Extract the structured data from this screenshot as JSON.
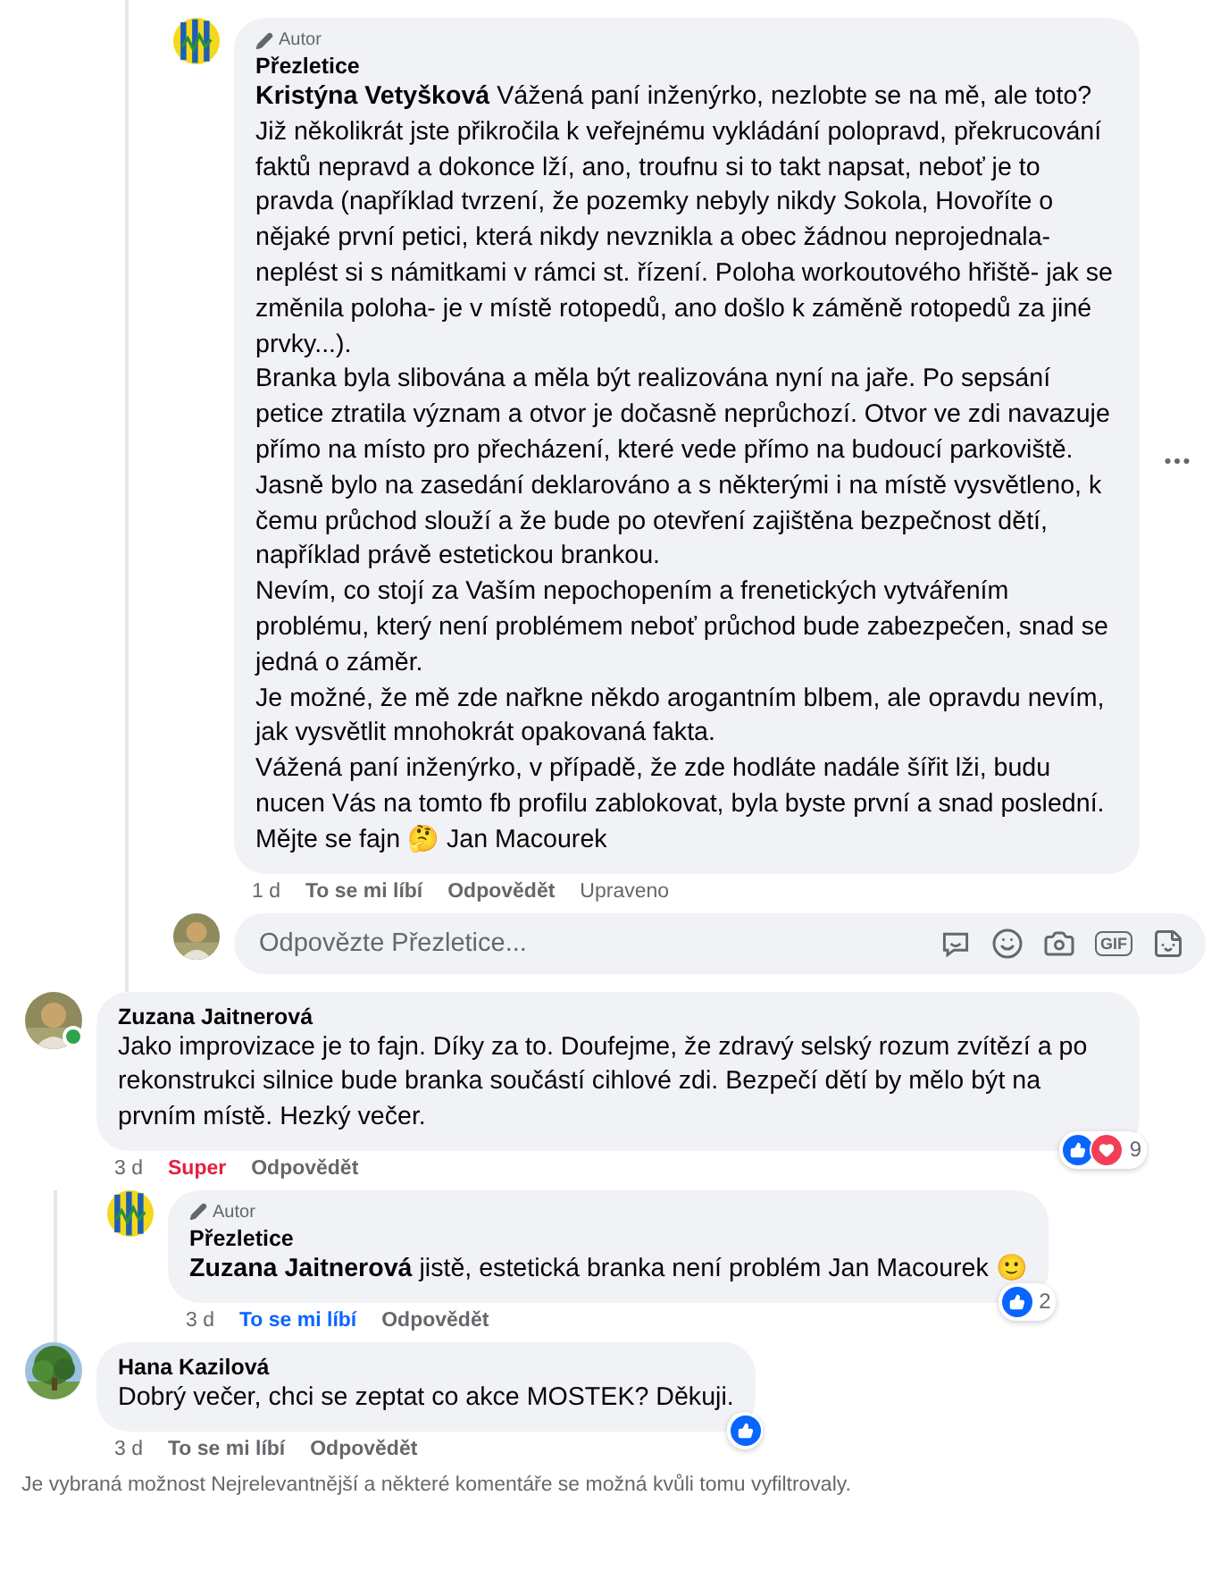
{
  "author_reply": {
    "badge": "Autor",
    "author": "Přezletice",
    "paragraphs": [
      "**Kristýna Vetyšková** Vážená paní inženýrko, nezlobte se na mě, ale toto? Již několikrát jste přikročila k veřejnému vykládání polopravd, překrucování faktů nepravd a dokonce lží, ano, troufnu si to takt napsat, neboť je to pravda (například tvrzení, že pozemky nebyly nikdy Sokola, Hovoříte o nějaké první petici, která nikdy nevznikla a obec žádnou neprojednala- neplést si s námitkami v rámci st. řízení. Poloha workoutového hřiště- jak se změnila poloha- je v místě rotopedů, ano došlo k záměně rotopedů za jiné prvky...).",
      "Branka byla slibována a měla být realizována nyní na jaře. Po sepsání petice ztratila význam a otvor je dočasně neprůchozí. Otvor ve zdi navazuje přímo na místo pro přecházení, které vede přímo na budoucí parkoviště.",
      "Jasně bylo na zasedání deklarováno a s některými i na místě vysvětleno, k čemu průchod slouží a že bude po otevření zajištěna bezpečnost dětí, například právě estetickou brankou.",
      "Nevím, co stojí za Vaším nepochopením a frenetických vytvářením problému, který není problémem neboť průchod bude zabezpečen, snad se jedná o záměr.",
      "Je možné, že mě zde nařkne někdo arogantním blbem, ale opravdu nevím, jak vysvětlit mnohokrát opakovaná fakta.",
      "Vážená paní inženýrko, v případě, že zde hodláte nadále šířit lži, budu nucen Vás na tomto fb profilu zablokovat, byla byste první a snad poslední.",
      "Mějte se fajn 🤔 Jan Macourek"
    ],
    "time": "1 d",
    "like": "To se mi líbí",
    "reply": "Odpovědět",
    "edited": "Upraveno"
  },
  "composer": {
    "placeholder": "Odpovězte Přezletice...",
    "gif_label": "GIF"
  },
  "comments": [
    {
      "author": "Zuzana Jaitnerová",
      "online": true,
      "text": "Jako improvizace je to fajn. Díky za to. Doufejme, že zdravý selský rozum zvítězí a po rekonstrukci silnice bude branka součástí cihlové zdi. Bezpečí dětí by mělo být na prvním místě. Hezký večer.",
      "reactions": [
        {
          "kind": "like"
        },
        {
          "kind": "love"
        }
      ],
      "reaction_count": "9",
      "time": "3 d",
      "my_reaction": {
        "kind": "love"
      },
      "like": "Super",
      "reply": "Odpovědět",
      "replies": [
        {
          "badge": "Autor",
          "author": "Přezletice",
          "text": "**Zuzana Jaitnerová** jistě, estetická branka není problém Jan Macourek 🙂",
          "reactions": [
            {
              "kind": "like"
            }
          ],
          "reaction_count": "2",
          "time": "3 d",
          "my_reaction": {
            "kind": "like"
          },
          "like": "To se mi líbí",
          "reply": "Odpovědět"
        }
      ]
    },
    {
      "author": "Hana Kazilová",
      "online": false,
      "text": "Dobrý večer, chci se zeptat co akce MOSTEK? Děkuji.",
      "reactions": [
        {
          "kind": "like"
        }
      ],
      "time": "3 d",
      "like": "To se mi líbí",
      "reply": "Odpovědět"
    }
  ],
  "filter_note": "Je vybraná možnost Nejrelevantnější a některé komentáře se možná kvůli tomu vyfiltrovaly."
}
